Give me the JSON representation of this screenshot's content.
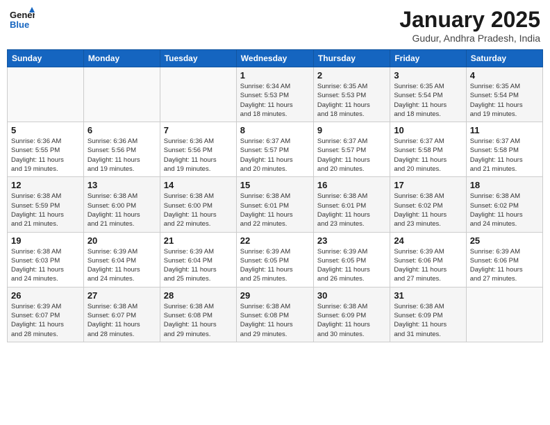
{
  "header": {
    "logo_line1": "General",
    "logo_line2": "Blue",
    "month": "January 2025",
    "location": "Gudur, Andhra Pradesh, India"
  },
  "weekdays": [
    "Sunday",
    "Monday",
    "Tuesday",
    "Wednesday",
    "Thursday",
    "Friday",
    "Saturday"
  ],
  "weeks": [
    [
      {
        "day": "",
        "info": ""
      },
      {
        "day": "",
        "info": ""
      },
      {
        "day": "",
        "info": ""
      },
      {
        "day": "1",
        "info": "Sunrise: 6:34 AM\nSunset: 5:53 PM\nDaylight: 11 hours\nand 18 minutes."
      },
      {
        "day": "2",
        "info": "Sunrise: 6:35 AM\nSunset: 5:53 PM\nDaylight: 11 hours\nand 18 minutes."
      },
      {
        "day": "3",
        "info": "Sunrise: 6:35 AM\nSunset: 5:54 PM\nDaylight: 11 hours\nand 18 minutes."
      },
      {
        "day": "4",
        "info": "Sunrise: 6:35 AM\nSunset: 5:54 PM\nDaylight: 11 hours\nand 19 minutes."
      }
    ],
    [
      {
        "day": "5",
        "info": "Sunrise: 6:36 AM\nSunset: 5:55 PM\nDaylight: 11 hours\nand 19 minutes."
      },
      {
        "day": "6",
        "info": "Sunrise: 6:36 AM\nSunset: 5:56 PM\nDaylight: 11 hours\nand 19 minutes."
      },
      {
        "day": "7",
        "info": "Sunrise: 6:36 AM\nSunset: 5:56 PM\nDaylight: 11 hours\nand 19 minutes."
      },
      {
        "day": "8",
        "info": "Sunrise: 6:37 AM\nSunset: 5:57 PM\nDaylight: 11 hours\nand 20 minutes."
      },
      {
        "day": "9",
        "info": "Sunrise: 6:37 AM\nSunset: 5:57 PM\nDaylight: 11 hours\nand 20 minutes."
      },
      {
        "day": "10",
        "info": "Sunrise: 6:37 AM\nSunset: 5:58 PM\nDaylight: 11 hours\nand 20 minutes."
      },
      {
        "day": "11",
        "info": "Sunrise: 6:37 AM\nSunset: 5:58 PM\nDaylight: 11 hours\nand 21 minutes."
      }
    ],
    [
      {
        "day": "12",
        "info": "Sunrise: 6:38 AM\nSunset: 5:59 PM\nDaylight: 11 hours\nand 21 minutes."
      },
      {
        "day": "13",
        "info": "Sunrise: 6:38 AM\nSunset: 6:00 PM\nDaylight: 11 hours\nand 21 minutes."
      },
      {
        "day": "14",
        "info": "Sunrise: 6:38 AM\nSunset: 6:00 PM\nDaylight: 11 hours\nand 22 minutes."
      },
      {
        "day": "15",
        "info": "Sunrise: 6:38 AM\nSunset: 6:01 PM\nDaylight: 11 hours\nand 22 minutes."
      },
      {
        "day": "16",
        "info": "Sunrise: 6:38 AM\nSunset: 6:01 PM\nDaylight: 11 hours\nand 23 minutes."
      },
      {
        "day": "17",
        "info": "Sunrise: 6:38 AM\nSunset: 6:02 PM\nDaylight: 11 hours\nand 23 minutes."
      },
      {
        "day": "18",
        "info": "Sunrise: 6:38 AM\nSunset: 6:02 PM\nDaylight: 11 hours\nand 24 minutes."
      }
    ],
    [
      {
        "day": "19",
        "info": "Sunrise: 6:38 AM\nSunset: 6:03 PM\nDaylight: 11 hours\nand 24 minutes."
      },
      {
        "day": "20",
        "info": "Sunrise: 6:39 AM\nSunset: 6:04 PM\nDaylight: 11 hours\nand 24 minutes."
      },
      {
        "day": "21",
        "info": "Sunrise: 6:39 AM\nSunset: 6:04 PM\nDaylight: 11 hours\nand 25 minutes."
      },
      {
        "day": "22",
        "info": "Sunrise: 6:39 AM\nSunset: 6:05 PM\nDaylight: 11 hours\nand 25 minutes."
      },
      {
        "day": "23",
        "info": "Sunrise: 6:39 AM\nSunset: 6:05 PM\nDaylight: 11 hours\nand 26 minutes."
      },
      {
        "day": "24",
        "info": "Sunrise: 6:39 AM\nSunset: 6:06 PM\nDaylight: 11 hours\nand 27 minutes."
      },
      {
        "day": "25",
        "info": "Sunrise: 6:39 AM\nSunset: 6:06 PM\nDaylight: 11 hours\nand 27 minutes."
      }
    ],
    [
      {
        "day": "26",
        "info": "Sunrise: 6:39 AM\nSunset: 6:07 PM\nDaylight: 11 hours\nand 28 minutes."
      },
      {
        "day": "27",
        "info": "Sunrise: 6:38 AM\nSunset: 6:07 PM\nDaylight: 11 hours\nand 28 minutes."
      },
      {
        "day": "28",
        "info": "Sunrise: 6:38 AM\nSunset: 6:08 PM\nDaylight: 11 hours\nand 29 minutes."
      },
      {
        "day": "29",
        "info": "Sunrise: 6:38 AM\nSunset: 6:08 PM\nDaylight: 11 hours\nand 29 minutes."
      },
      {
        "day": "30",
        "info": "Sunrise: 6:38 AM\nSunset: 6:09 PM\nDaylight: 11 hours\nand 30 minutes."
      },
      {
        "day": "31",
        "info": "Sunrise: 6:38 AM\nSunset: 6:09 PM\nDaylight: 11 hours\nand 31 minutes."
      },
      {
        "day": "",
        "info": ""
      }
    ]
  ]
}
